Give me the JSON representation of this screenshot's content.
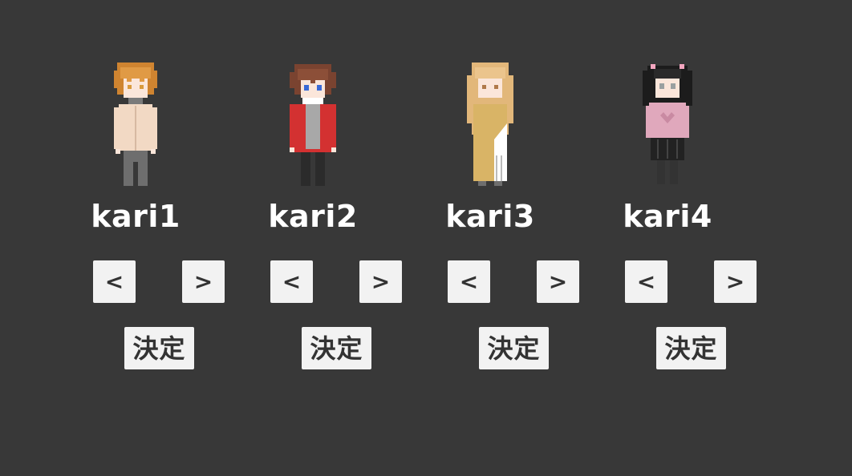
{
  "characters": [
    {
      "name": "kari1",
      "prev_label": "<",
      "next_label": ">",
      "confirm_label": "決定",
      "colors": {
        "hair": "#cf8430",
        "top": "#f2d9c4",
        "bottom": "#6e6e6e",
        "accent": "#7a7a7a",
        "skin": "#fbe6da",
        "eyes": "#d99a3c"
      }
    },
    {
      "name": "kari2",
      "prev_label": "<",
      "next_label": ">",
      "confirm_label": "決定",
      "colors": {
        "hair": "#7a4330",
        "top": "#d33131",
        "bottom": "#2b2b2b",
        "accent": "#a8a8a8",
        "skin": "#fbe6da",
        "eyes": "#3a6ad6"
      }
    },
    {
      "name": "kari3",
      "prev_label": "<",
      "next_label": ">",
      "confirm_label": "決定",
      "colors": {
        "hair": "#e2b77a",
        "top": "#d9b466",
        "bottom": "#ffffff",
        "accent": "#ffffff",
        "skin": "#fbe6da",
        "eyes": "#b07a4a"
      }
    },
    {
      "name": "kari4",
      "prev_label": "<",
      "next_label": ">",
      "confirm_label": "決定",
      "colors": {
        "hair": "#1c1c1c",
        "top": "#e0a8bc",
        "bottom": "#222222",
        "accent": "#f4a6c0",
        "skin": "#fbe6da",
        "eyes": "#9aa0a0"
      }
    }
  ]
}
